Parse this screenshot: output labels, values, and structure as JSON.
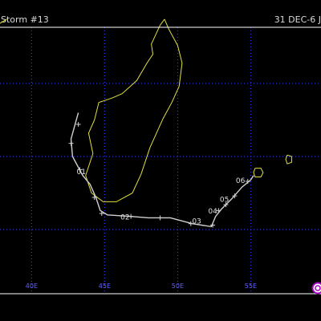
{
  "header": {
    "title": "Storm #13",
    "dates": "31 DEC-6 J"
  },
  "map": {
    "projection": "equirectangular",
    "lon_range_visible": [
      35.8,
      58.7
    ],
    "lat_range_visible": [
      -10.6,
      -28.8
    ],
    "gridlines": {
      "longitudes": [
        40,
        45,
        50,
        55
      ],
      "latitudes": [
        -15,
        -20,
        -25
      ]
    },
    "longitude_labels": [
      {
        "lon": 40,
        "text": "40E"
      },
      {
        "lon": 45,
        "text": "45E"
      },
      {
        "lon": 50,
        "text": "50E"
      },
      {
        "lon": 55,
        "text": "55E"
      }
    ],
    "colors": {
      "background": "#000000",
      "gridline": "#3a3aff",
      "coastline": "#e0e040",
      "track": "#d0d0d0",
      "frame": "#ffffff",
      "axis_label": "#6060ff",
      "logo": "#a000c0"
    },
    "logo_icon": "copyright-circle-icon"
  },
  "track": {
    "points": [
      [
        43.2,
        -17.0
      ],
      [
        42.7,
        -18.8
      ],
      [
        42.8,
        -20.0
      ],
      [
        43.5,
        -21.3
      ],
      [
        44.0,
        -21.9
      ],
      [
        44.4,
        -22.8
      ],
      [
        44.7,
        -23.7
      ],
      [
        45.2,
        -24.0
      ],
      [
        46.7,
        -24.1
      ],
      [
        48.0,
        -24.2
      ],
      [
        49.5,
        -24.2
      ],
      [
        51.0,
        -24.6
      ],
      [
        52.3,
        -24.8
      ],
      [
        52.6,
        -24.1
      ],
      [
        53.0,
        -23.6
      ],
      [
        53.7,
        -22.9
      ],
      [
        54.4,
        -22.1
      ],
      [
        55.0,
        -21.6
      ],
      [
        55.2,
        -21.3
      ]
    ],
    "tick_points": [
      [
        43.2,
        -17.8
      ],
      [
        42.7,
        -19.1
      ],
      [
        43.3,
        -20.9
      ],
      [
        44.3,
        -22.8
      ],
      [
        44.8,
        -23.9
      ],
      [
        46.8,
        -24.1
      ],
      [
        48.8,
        -24.2
      ],
      [
        50.9,
        -24.6
      ],
      [
        52.4,
        -24.7
      ],
      [
        52.8,
        -23.7
      ],
      [
        53.3,
        -23.3
      ],
      [
        53.9,
        -22.7
      ],
      [
        54.8,
        -21.7
      ]
    ],
    "day_labels": [
      {
        "text": "01",
        "lon": 43.4,
        "lat": -21.2
      },
      {
        "text": "02",
        "lon": 46.4,
        "lat": -24.3
      },
      {
        "text": "03",
        "lon": 51.3,
        "lat": -24.6
      },
      {
        "text": "04",
        "lon": 52.4,
        "lat": -23.9
      },
      {
        "text": "05",
        "lon": 53.2,
        "lat": -23.1
      },
      {
        "text": "06",
        "lon": 54.3,
        "lat": -21.8
      }
    ]
  },
  "coastlines": [
    {
      "name": "Africa",
      "points": [
        [
          35.8,
          -12.2
        ],
        [
          36.5,
          -11.7
        ],
        [
          37.2,
          -11.4
        ],
        [
          37.8,
          -10.9
        ],
        [
          38.3,
          -10.6
        ]
      ]
    },
    {
      "name": "Madagascar",
      "points": [
        [
          49.1,
          -10.6
        ],
        [
          48.8,
          -11.0
        ],
        [
          48.2,
          -12.3
        ],
        [
          48.3,
          -13.0
        ],
        [
          47.9,
          -13.6
        ],
        [
          47.2,
          -14.8
        ],
        [
          46.2,
          -15.7
        ],
        [
          45.5,
          -16.0
        ],
        [
          44.6,
          -16.3
        ],
        [
          44.3,
          -17.5
        ],
        [
          43.9,
          -18.4
        ],
        [
          44.2,
          -19.8
        ],
        [
          43.7,
          -21.3
        ],
        [
          44.1,
          -22.5
        ],
        [
          44.9,
          -23.1
        ],
        [
          45.8,
          -23.1
        ],
        [
          46.9,
          -22.5
        ],
        [
          47.5,
          -21.2
        ],
        [
          48.1,
          -19.4
        ],
        [
          49.0,
          -17.4
        ],
        [
          49.6,
          -16.3
        ],
        [
          50.1,
          -15.2
        ],
        [
          50.3,
          -13.6
        ],
        [
          50.0,
          -12.4
        ],
        [
          49.4,
          -11.3
        ],
        [
          49.1,
          -10.6
        ]
      ]
    },
    {
      "name": "Reunion",
      "points": [
        [
          55.3,
          -20.8
        ],
        [
          55.7,
          -20.8
        ],
        [
          55.85,
          -21.1
        ],
        [
          55.7,
          -21.4
        ],
        [
          55.3,
          -21.4
        ],
        [
          55.2,
          -21.1
        ],
        [
          55.3,
          -20.8
        ]
      ]
    },
    {
      "name": "Mauritius",
      "points": [
        [
          57.5,
          -19.9
        ],
        [
          57.8,
          -20.0
        ],
        [
          57.8,
          -20.4
        ],
        [
          57.5,
          -20.5
        ],
        [
          57.4,
          -20.2
        ],
        [
          57.5,
          -19.9
        ]
      ]
    }
  ]
}
